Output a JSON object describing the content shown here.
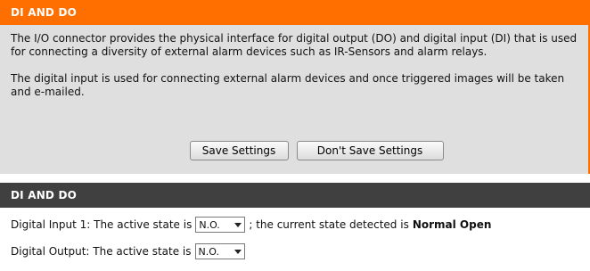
{
  "section1": {
    "title": "DI AND DO",
    "description_p1": "The I/O connector provides the physical interface for digital output (DO) and digital input (DI) that is used for connecting a diversity of external alarm devices such as IR-Sensors and alarm relays.",
    "description_p2": "The digital input is used for connecting external alarm devices and once triggered images will be taken and e-mailed.",
    "save_label": "Save Settings",
    "dont_save_label": "Don't Save Settings"
  },
  "section2": {
    "title": "DI AND DO",
    "di1_label": "Digital Input 1: The active state is",
    "di1_select_value": "N.O.",
    "di1_current_text": "; the current state detected is",
    "di1_current_state": "Normal Open",
    "do_label": "Digital Output: The active state is",
    "do_select_value": "N.O."
  },
  "colors": {
    "accent": "#ff6f00",
    "dark_header": "#404040",
    "panel_bg": "#dfdfdf"
  },
  "icons": {
    "dropdown": "chevron-down-icon"
  }
}
